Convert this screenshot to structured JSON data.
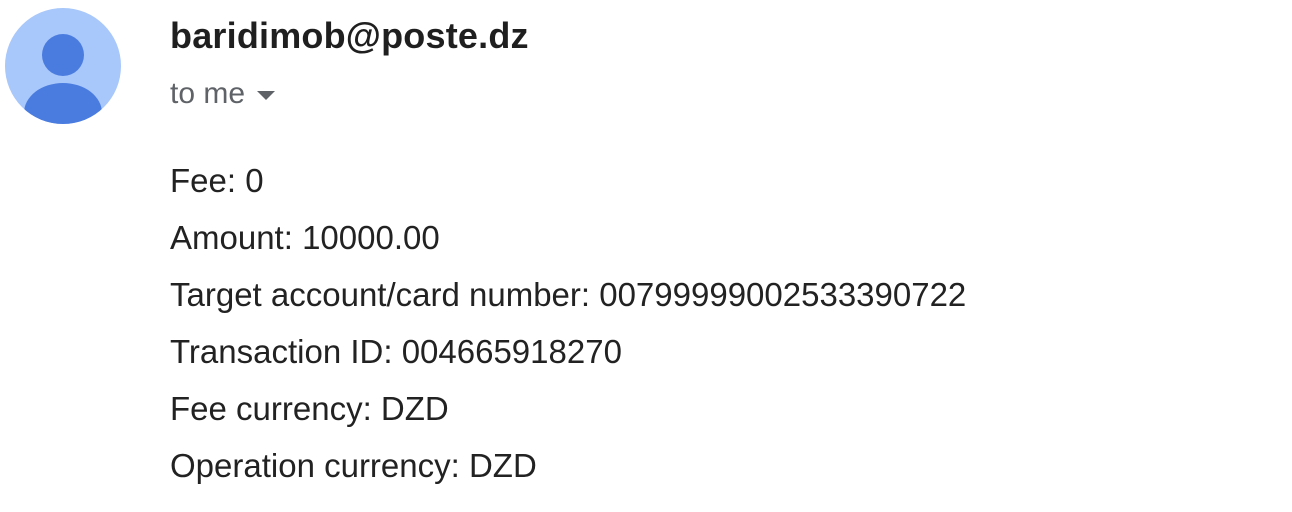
{
  "message": {
    "sender_email": "baridimob@poste.dz",
    "recipient_label": "to me",
    "recipient_toggle_icon": "caret-down-icon",
    "avatar_icon": "person-icon",
    "avatar_colors": {
      "background": "#a8c7fa",
      "figure": "#4a7ce0"
    },
    "body_lines": [
      "Fee: 0",
      "Amount: 10000.00",
      "Target account/card number: 00799999002533390722",
      "Transaction ID: 004665918270",
      "Fee currency: DZD",
      "Operation currency: DZD"
    ]
  }
}
